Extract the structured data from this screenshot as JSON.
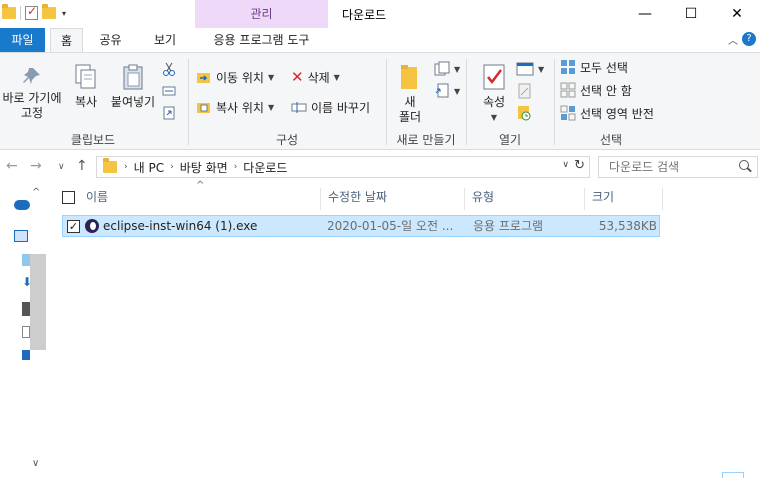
{
  "window": {
    "title": "다운로드",
    "context_tab_group": "관리",
    "controls": {
      "minimize": "—",
      "maximize": "☐",
      "close": "✕"
    }
  },
  "tabs": {
    "file": "파일",
    "home": "홈",
    "share": "공유",
    "view": "보기",
    "app_tools": "응용 프로그램 도구"
  },
  "ribbon": {
    "clipboard": {
      "label": "클립보드",
      "pin_line1": "바로 가기에",
      "pin_line2": "고정",
      "copy": "복사",
      "paste": "붙여넣기"
    },
    "organize": {
      "label": "구성",
      "move_to": "이동 위치",
      "copy_to": "복사 위치",
      "delete": "삭제",
      "rename": "이름 바꾸기"
    },
    "new": {
      "label": "새로 만들기",
      "new_folder_line1": "새",
      "new_folder_line2": "폴더"
    },
    "open": {
      "label": "열기",
      "properties": "속성"
    },
    "select": {
      "label": "선택",
      "select_all": "모두 선택",
      "select_none": "선택 안 함",
      "invert_selection": "선택 영역 반전"
    }
  },
  "address_bar": {
    "crumbs": [
      "내 PC",
      "바탕 화면",
      "다운로드"
    ],
    "search_placeholder": "다운로드 검색"
  },
  "file_list": {
    "columns": [
      "이름",
      "수정한 날짜",
      "유형",
      "크기"
    ],
    "rows": [
      {
        "name": "eclipse-inst-win64 (1).exe",
        "modified": "2020-01-05-일 오전 ...",
        "type": "응용 프로그램",
        "size": "53,538KB"
      }
    ]
  }
}
